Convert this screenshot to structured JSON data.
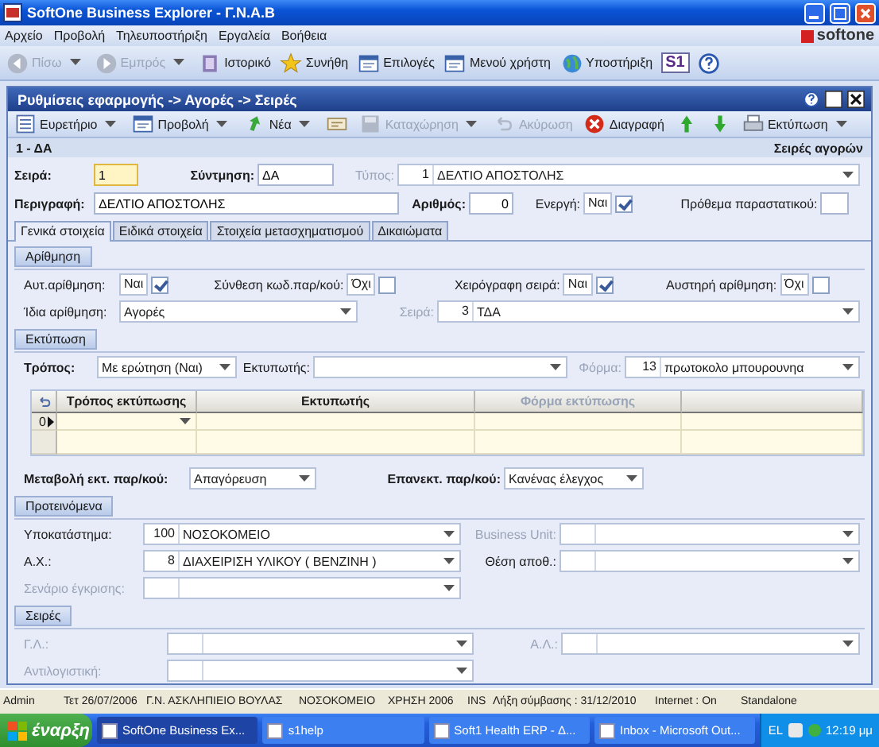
{
  "window": {
    "title": "SoftOne Business Explorer - Γ.Ν.Α.Β"
  },
  "menu": [
    "Αρχείο",
    "Προβολή",
    "Τηλευποστήριξη",
    "Εργαλεία",
    "Βοήθεια"
  ],
  "logo": "softone",
  "toolbar": [
    {
      "kind": "button",
      "label": "Πίσω",
      "disabled": true,
      "dropdown": true
    },
    {
      "kind": "button",
      "label": "Εμπρός",
      "disabled": true,
      "dropdown": true
    },
    {
      "kind": "button",
      "label": "Ιστορικό"
    },
    {
      "kind": "button",
      "label": "Συνήθη"
    },
    {
      "kind": "button",
      "label": "Επιλογές"
    },
    {
      "kind": "button",
      "label": "Μενού χρήστη"
    },
    {
      "kind": "button",
      "label": "Υποστήριξη"
    },
    {
      "kind": "logo",
      "label": "S1"
    },
    {
      "kind": "icon"
    }
  ],
  "inner_window": {
    "title": "Ρυθμίσεις εφαρμογής -> Αγορές -> Σειρές"
  },
  "record_toolbar": [
    {
      "kind": "button",
      "label": "Ευρετήριο",
      "dropdown": true
    },
    {
      "kind": "button",
      "label": "Προβολή",
      "dropdown": true
    },
    {
      "kind": "button",
      "label": "Νέα",
      "dropdown": true
    },
    {
      "kind": "icon"
    },
    {
      "kind": "button",
      "label": "Καταχώρηση",
      "disabled": true,
      "dropdown": true
    },
    {
      "kind": "button",
      "label": "Ακύρωση",
      "disabled": true
    },
    {
      "kind": "button",
      "label": "Διαγραφή"
    },
    {
      "kind": "icon"
    },
    {
      "kind": "icon"
    },
    {
      "kind": "button",
      "label": "Εκτύπωση",
      "dropdown": true
    }
  ],
  "record": {
    "title": "1 - ΔΑ",
    "object": "Σειρές αγορών"
  },
  "form": [
    {
      "fields": [
        {
          "label": "Σειρά:",
          "kind": "text",
          "value": "1",
          "required": true,
          "focused": true
        },
        {
          "label": "Σύντμηση:",
          "kind": "text",
          "value": "ΔΑ",
          "required": true
        },
        {
          "label": "Τύπος:",
          "kind": "code_combo",
          "code": "1",
          "value": "ΔΕΛΤΙΟ ΑΠΟΣΤΟΛΗΣ",
          "disabled": true
        }
      ]
    },
    {
      "fields": [
        {
          "label": "Περιγραφή:",
          "kind": "text",
          "value": "ΔΕΛΤΙΟ ΑΠΟΣΤΟΛΗΣ",
          "required": true
        },
        {
          "label": "Αριθμός:",
          "kind": "number",
          "value": "0",
          "required": true
        },
        {
          "label": "Ενεργή:",
          "kind": "check",
          "value": "Ναι",
          "checked": true
        },
        {
          "label": "Πρόθεμα παραστατικού:",
          "kind": "text"
        }
      ]
    }
  ],
  "tabs": [
    {
      "label": "Γενικά στοιχεία",
      "selected": true
    },
    {
      "label": "Ειδικά στοιχεία",
      "selected": false
    },
    {
      "label": "Στοιχεία μετασχηματισμού",
      "selected": false
    },
    {
      "label": "Δικαιώματα",
      "selected": false
    }
  ],
  "groups": [
    {
      "title": "Αρίθμηση",
      "items": [
        {
          "kind": "row",
          "fields": [
            {
              "label": "Αυτ.αρίθμηση:",
              "kind": "check",
              "value": "Ναι",
              "checked": true
            },
            {
              "label": "Σύνθεση κωδ.παρ/κού:",
              "kind": "check",
              "value": "Όχι",
              "checked": false
            },
            {
              "label": "Χειρόγραφη σειρά:",
              "kind": "check",
              "value": "Ναι",
              "checked": true
            },
            {
              "label": "Αυστηρή αρίθμηση:",
              "kind": "check",
              "value": "Όχι",
              "checked": false
            }
          ]
        },
        {
          "kind": "row",
          "fields": [
            {
              "label": "Ίδια αρίθμηση:",
              "kind": "combo",
              "value": "Αγορές"
            },
            {
              "label": "Σειρά:",
              "kind": "code_combo",
              "code": "3",
              "value": "ΤΔΑ",
              "disabled": true
            }
          ]
        }
      ]
    },
    {
      "title": "Εκτύπωση",
      "items": [
        {
          "kind": "row",
          "fields": [
            {
              "label": "Τρόπος:",
              "kind": "combo",
              "value": "Με ερώτηση (Ναι)",
              "required": true
            },
            {
              "label": "Εκτυπωτής:",
              "kind": "combo"
            },
            {
              "label": "Φόρμα:",
              "kind": "code_combo",
              "code": "13",
              "value": "πρωτοκολο μπουρουνηα",
              "disabled": true
            }
          ]
        },
        {
          "kind": "grid",
          "columns": [
            {
              "label": "Τρόπος εκτύπωσης"
            },
            {
              "label": "Εκτυπωτής"
            },
            {
              "label": "Φόρμα εκτύπωσης",
              "disabled": true
            }
          ],
          "rows": [
            {
              "index": "0",
              "current": true
            }
          ]
        },
        {
          "kind": "row",
          "fields": [
            {
              "label": "Μεταβολή εκτ. παρ/κού:",
              "kind": "combo",
              "value": "Απαγόρευση",
              "required": true
            },
            {
              "label": "Επανεκτ. παρ/κού:",
              "kind": "combo",
              "value": "Κανένας έλεγχος",
              "required": true
            }
          ]
        }
      ]
    },
    {
      "title": "Προτεινόμενα",
      "items": [
        {
          "kind": "row",
          "fields": [
            {
              "label": "Υποκατάστημα:",
              "kind": "code_combo",
              "code": "100",
              "value": "ΝΟΣΟΚΟΜΕΙΟ"
            },
            {
              "label": "Business Unit:",
              "kind": "code_combo",
              "disabled": true
            }
          ]
        },
        {
          "kind": "row",
          "fields": [
            {
              "label": "Α.Χ.:",
              "kind": "code_combo",
              "code": "8",
              "value": "ΔΙΑΧΕΙΡΙΣΗ ΥΛΙΚΟΥ ( ΒΕΝΖΙΝΗ )"
            },
            {
              "label": "Θέση αποθ.:",
              "kind": "code_combo"
            }
          ]
        },
        {
          "kind": "row",
          "fields": [
            {
              "label": "Σενάριο έγκρισης:",
              "kind": "code_combo",
              "disabled": true
            }
          ]
        }
      ]
    },
    {
      "title": "Σειρές",
      "items": [
        {
          "kind": "row",
          "fields": [
            {
              "label": "Γ.Λ.:",
              "kind": "code_combo",
              "disabled": true
            },
            {
              "label": "Α.Λ.:",
              "kind": "code_combo",
              "disabled": true
            }
          ]
        },
        {
          "kind": "row",
          "fields": [
            {
              "label": "Αντιλογιστική:",
              "kind": "code_combo",
              "disabled": true
            }
          ]
        }
      ]
    }
  ],
  "status_bar": [
    "Admin",
    "Τετ 26/07/2006",
    "Γ.Ν. ΑΣΚΛΗΠΙΕΙΟ ΒΟΥΛΑΣ",
    "ΝΟΣΟΚΟΜΕΙΟ",
    "ΧΡΗΣΗ 2006",
    "INS",
    "Λήξη σύμβασης : 31/12/2010",
    "Internet : On",
    "Standalone"
  ],
  "taskbar": {
    "start": "έναρξη",
    "tasks": [
      {
        "label": "SoftOne Business Ex...",
        "selected": true
      },
      {
        "label": "s1help",
        "selected": false
      },
      {
        "label": "Soft1 Health ERP - Δ...",
        "selected": false
      },
      {
        "label": "Inbox - Microsoft Out...",
        "selected": false
      }
    ],
    "language": "EL",
    "clock": "12:19 μμ"
  }
}
